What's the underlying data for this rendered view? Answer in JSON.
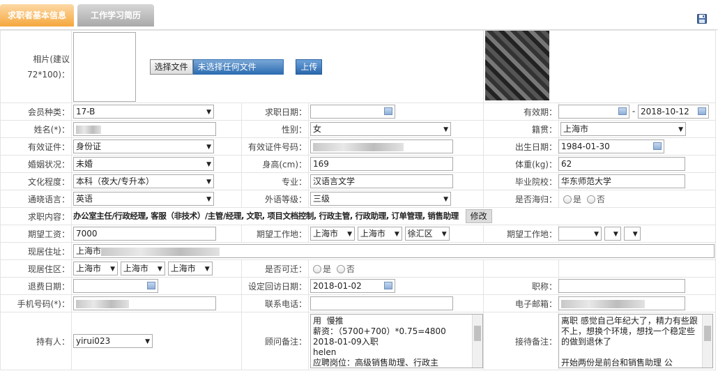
{
  "tabs": [
    {
      "label": "求职者基本信息"
    },
    {
      "label": "工作学习简历"
    }
  ],
  "photo": {
    "label": "相片(建议72*100)：",
    "choose_file": "选择文件",
    "no_file": "未选择任何文件",
    "upload": "上传"
  },
  "labels": {
    "member_type": "会员种类：",
    "job_date": "求职日期：",
    "valid_period": "有效期：",
    "name": "姓名(*)：",
    "gender": "性别：",
    "native": "籍贯：",
    "id_type": "有效证件：",
    "id_number": "有效证件号码：",
    "birth": "出生日期：",
    "marital": "婚姻状况：",
    "height": "身高(cm)：",
    "weight": "体重(kg)：",
    "education": "文化程度：",
    "major": "专业：",
    "school": "毕业院校：",
    "language": "通晓语言：",
    "lang_level": "外语等级：",
    "overseas": "是否海归：",
    "job_content": "求职内容：",
    "salary": "期望工资：",
    "work_place": "期望工作地：",
    "work_place2": "期望工作地：",
    "address": "现居住址：",
    "district": "现居住区：",
    "relocate": "是否可迁：",
    "refund_date": "退费日期：",
    "revisit_date": "设定回访日期：",
    "title": "职称：",
    "mobile": "手机号码(*)：",
    "phone": "联系电话：",
    "email": "电子邮箱：",
    "holder": "持有人：",
    "consultant_note": "顾问备注：",
    "reception_note": "接待备注："
  },
  "values": {
    "member_type": "17-B",
    "valid_to": "2018-10-12",
    "gender": "女",
    "native": "上海市",
    "id_type": "身份证",
    "birth": "1984-01-30",
    "marital": "未婚",
    "height": "169",
    "weight": "62",
    "education": "本科（夜大/专升本）",
    "major": "汉语言文学",
    "school": "华东师范大学",
    "language": "英语",
    "lang_level": "三级",
    "yes": "是",
    "no": "否",
    "job_content": "办公室主任/行政经理, 客服（非技术）/主管/经理, 文职, 项目文档控制, 行政主管, 行政助理, 订单管理, 销售助理",
    "modify": "修改",
    "salary": "7000",
    "work_city": "上海市",
    "work_city2": "上海市",
    "work_district": "徐汇区",
    "address_prefix": "上海市",
    "district1": "上海市",
    "district2": "上海市",
    "district3": "上海市",
    "revisit_date": "2018-01-02",
    "holder": "yirui023",
    "consultant_note": "用  慢推\n薪资：（5700+700）*0.75=4800\n2018-01-09入职\nhelen\n应聘岗位：高级销售助理、行政主",
    "reception_note": "离职 感觉自己年纪大了，精力有些跟不上，想换个环境，想找一个稳定些的做到退休了\n\n开始两份是前台和销售助理 公"
  }
}
